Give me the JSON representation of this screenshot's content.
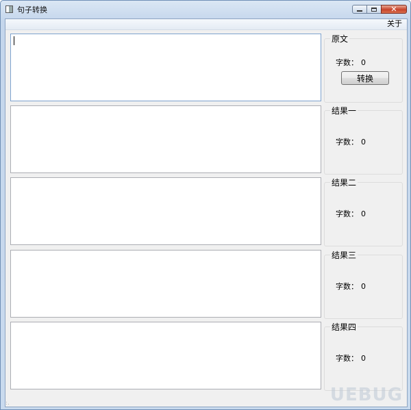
{
  "window": {
    "title": "句子转换",
    "close_glyph": "✕"
  },
  "menu": {
    "about": "关于"
  },
  "count_label": "字数：",
  "sections": [
    {
      "title": "原文",
      "count": "0",
      "button": "转换"
    },
    {
      "title": "结果一",
      "count": "0"
    },
    {
      "title": "结果二",
      "count": "0"
    },
    {
      "title": "结果三",
      "count": "0"
    },
    {
      "title": "结果四",
      "count": "0"
    }
  ],
  "watermark": "UEBUG",
  "colors": {
    "title_gradient_top": "#dbe7f4",
    "client_bg": "#f0f0f0",
    "close_button": "#c7432b"
  }
}
